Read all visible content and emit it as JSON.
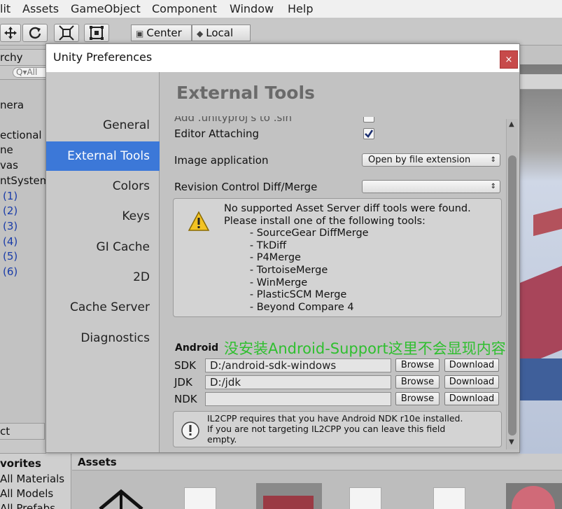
{
  "menubar": {
    "items": [
      "lit",
      "Assets",
      "GameObject",
      "Component",
      "Window",
      "Help"
    ]
  },
  "toolbar": {
    "pivot_center": "Center",
    "pivot_local": "Local"
  },
  "hierarchy": {
    "tab_label": "rchy",
    "search_placeholder": "Q▾All",
    "items": [
      "nera",
      "ectional L",
      "ne",
      "vas",
      "ntSystem",
      "(1)",
      "(2)",
      "(3)",
      "(4)",
      "(5)",
      "(6)"
    ]
  },
  "project": {
    "tab_label": "ct",
    "favorites_label": "vorites",
    "favorites": [
      "All Materials",
      "All Models",
      "All Prefabs"
    ],
    "assets_label": "Assets"
  },
  "prefs": {
    "title": "Unity Preferences",
    "close_label": "×",
    "nav": [
      "General",
      "External Tools",
      "Colors",
      "Keys",
      "GI Cache",
      "2D",
      "Cache Server",
      "Diagnostics"
    ],
    "selected_nav": "External Tools",
    "content_title": "External Tools",
    "partial_row_label": "Add .unityproj's to .sln",
    "editor_attaching_label": "Editor Attaching",
    "editor_attaching_checked": true,
    "image_app_label": "Image application",
    "image_app_value": "Open by file extension",
    "revision_label": "Revision Control Diff/Merge",
    "revision_value": "",
    "diff_help": "No supported Asset Server diff tools were found.\nPlease install one of the following tools:\n        - SourceGear DiffMerge\n        - TkDiff\n        - P4Merge\n        - TortoiseMerge\n        - WinMerge\n        - PlasticSCM Merge\n        - Beyond Compare 4",
    "android_label": "Android",
    "sdk_label": "SDK",
    "sdk_value": "D:/android-sdk-windows",
    "jdk_label": "JDK",
    "jdk_value": "D:/jdk",
    "ndk_label": "NDK",
    "ndk_value": "",
    "browse_label": "Browse",
    "download_label": "Download",
    "il2cpp_help": "IL2CPP requires that you have Android NDK r10e installed.\nIf you are not targeting IL2CPP you can leave this field\nempty."
  },
  "annotation": "没安装Android-Support这里不会显现内容",
  "colors": {
    "selection": "#3c78d8",
    "close": "#c74a4a",
    "annotation": "#2fbf2f"
  }
}
